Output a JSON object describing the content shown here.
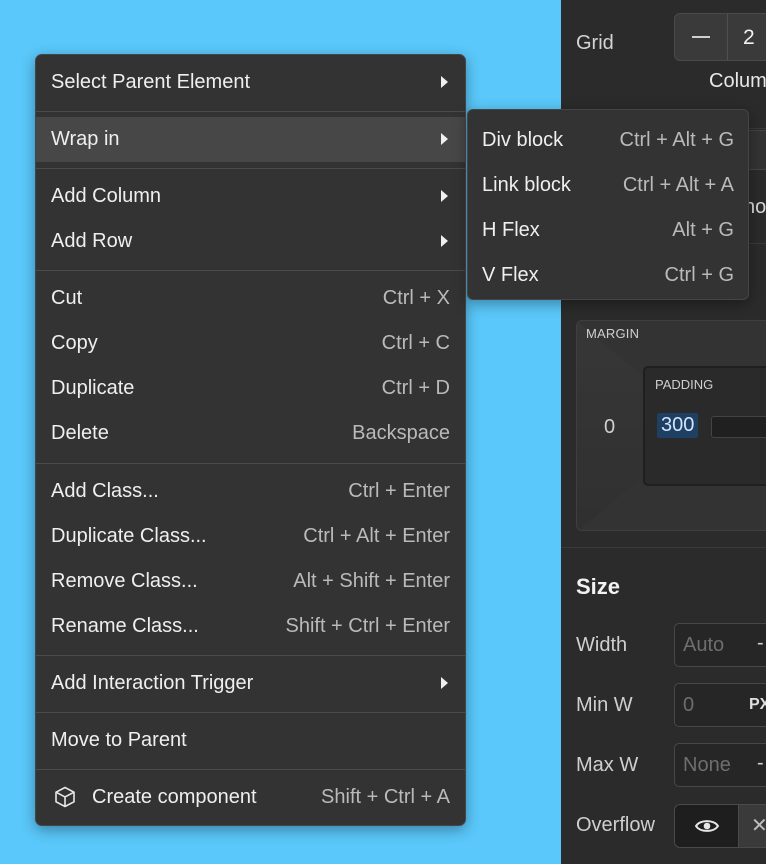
{
  "style_panel": {
    "grid_label": "Grid",
    "grid_value": "2",
    "grid_caption": "Colum",
    "hidden_text": "no",
    "margin_label": "MARGIN",
    "margin_left": "0",
    "padding_label": "PADDING",
    "padding_left": "300",
    "size_title": "Size",
    "width_label": "Width",
    "width_placeholder": "Auto",
    "width_trailing": "-",
    "min_w_label": "Min W",
    "min_w_placeholder": "0",
    "min_w_unit": "PX",
    "max_w_label": "Max W",
    "max_w_placeholder": "None",
    "max_w_trailing": "-",
    "overflow_label": "Overflow"
  },
  "context_menu": {
    "select_parent": "Select Parent Element",
    "wrap_in": "Wrap in",
    "add_column": "Add Column",
    "add_row": "Add Row",
    "cut": {
      "label": "Cut",
      "shortcut": "Ctrl + X"
    },
    "copy": {
      "label": "Copy",
      "shortcut": "Ctrl + C"
    },
    "duplicate": {
      "label": "Duplicate",
      "shortcut": "Ctrl + D"
    },
    "delete": {
      "label": "Delete",
      "shortcut": "Backspace"
    },
    "add_class": {
      "label": "Add Class...",
      "shortcut": "Ctrl + Enter"
    },
    "duplicate_class": {
      "label": "Duplicate Class...",
      "shortcut": "Ctrl + Alt + Enter"
    },
    "remove_class": {
      "label": "Remove Class...",
      "shortcut": "Alt + Shift + Enter"
    },
    "rename_class": {
      "label": "Rename Class...",
      "shortcut": "Shift + Ctrl + Enter"
    },
    "add_interaction_trigger": "Add Interaction Trigger",
    "move_to_parent": "Move to Parent",
    "create_component": {
      "label": "Create component",
      "shortcut": "Shift + Ctrl + A"
    }
  },
  "wrap_submenu": [
    {
      "label": "Div block",
      "shortcut": "Ctrl + Alt + G"
    },
    {
      "label": "Link block",
      "shortcut": "Ctrl + Alt + A"
    },
    {
      "label": "H Flex",
      "shortcut": "Alt + G"
    },
    {
      "label": "V Flex",
      "shortcut": "Ctrl + G"
    }
  ],
  "colors": {
    "canvas": "#5ac8fa",
    "menu_bg": "#333333",
    "menu_highlight": "#474747",
    "panel_bg": "#2b2b2b",
    "selected_value_bg": "#1f3f63"
  }
}
